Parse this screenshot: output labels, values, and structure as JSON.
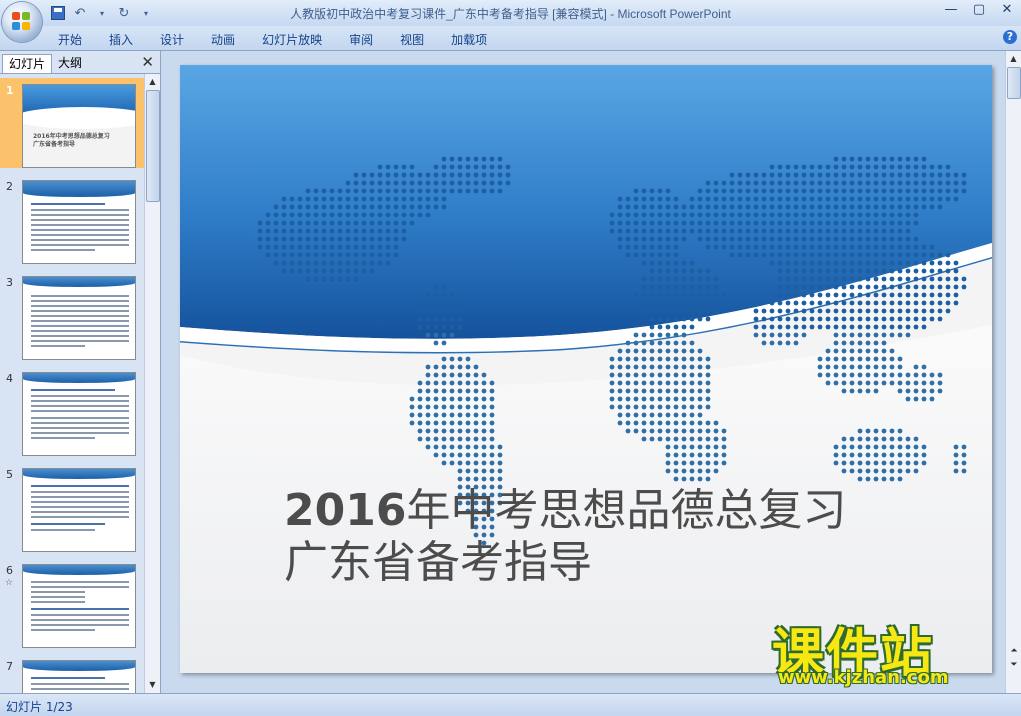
{
  "window": {
    "title": "人教版初中政治中考复习课件_广东中考备考指导 [兼容模式] - Microsoft PowerPoint",
    "controls": [
      "—",
      "▢",
      "✕"
    ]
  },
  "quick_access": {
    "save_icon": "save-icon",
    "undo_icon": "undo-icon",
    "redo_icon": "redo-icon"
  },
  "ribbon": {
    "tabs": [
      "开始",
      "插入",
      "设计",
      "动画",
      "幻灯片放映",
      "审阅",
      "视图",
      "加载项"
    ],
    "help": "?"
  },
  "left_pane": {
    "tab_slides": "幻灯片",
    "tab_outline": "大纲",
    "close": "✕",
    "thumbnails": [
      {
        "number": "1",
        "title": "2016年中考思想品德总复习 广东省备考指导",
        "selected": true
      },
      {
        "number": "2",
        "title": "",
        "selected": false
      },
      {
        "number": "3",
        "title": "",
        "selected": false
      },
      {
        "number": "4",
        "title": "",
        "selected": false
      },
      {
        "number": "5",
        "title": "",
        "selected": false
      },
      {
        "number": "6",
        "title": "",
        "selected": false
      },
      {
        "number": "7",
        "title": "",
        "selected": false
      }
    ]
  },
  "slide": {
    "title_year": "2016",
    "title_line1_rest": "年中考思想品德总复习",
    "title_line2": "广东省备考指导"
  },
  "watermark": {
    "text": "课件站",
    "url": "www.kjzhan.com"
  },
  "status": {
    "slide_indicator": "幻灯片 1/23"
  },
  "colors": {
    "accent": "#1c64b0",
    "selection": "#fbc16b",
    "watermark_fill": "#f7e814",
    "watermark_outline": "#2f6b2f"
  }
}
